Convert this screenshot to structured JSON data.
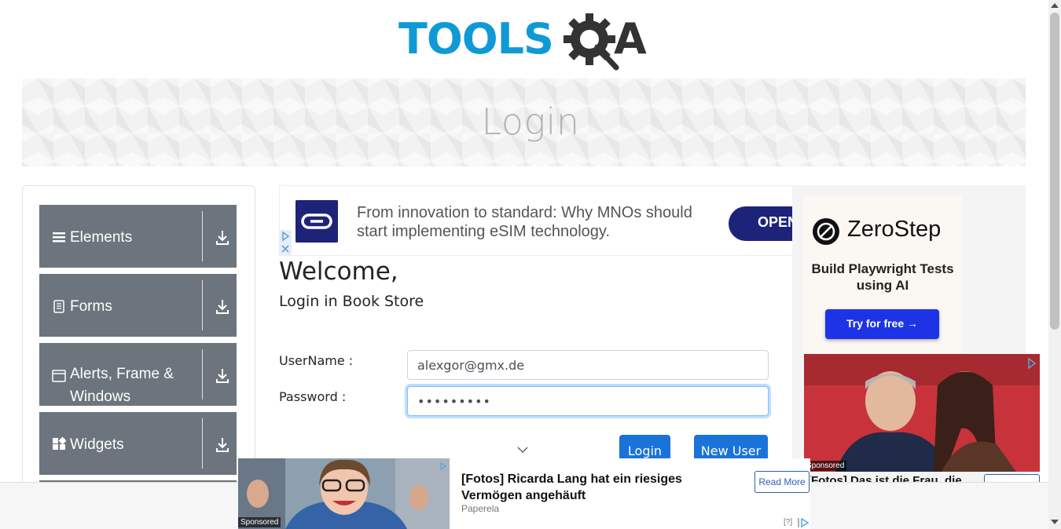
{
  "header": {
    "logo_text": "TOOLSQA",
    "banner_title": "Login"
  },
  "sidebar": {
    "groups": [
      {
        "label": "Elements",
        "icon": "list-icon"
      },
      {
        "label": "Forms",
        "icon": "document-icon"
      },
      {
        "label": "Alerts, Frame & Windows",
        "icon": "window-icon"
      },
      {
        "label": "Widgets",
        "icon": "widgets-icon"
      }
    ]
  },
  "top_ad": {
    "text": "From innovation to standard: Why MNOs should start implementing eSIM technology.",
    "button": "OPEN"
  },
  "form": {
    "welcome": "Welcome,",
    "subtitle": "Login in Book Store",
    "username_label": "UserName :",
    "username_value": "alexgor@gmx.de",
    "password_label": "Password :",
    "password_value": "•••••••••",
    "login_button": "Login",
    "new_user_button": "New User"
  },
  "right_ad": {
    "brand": "ZeroStep",
    "tagline": "Build Playwright Tests using AI",
    "cta": "Try for free →",
    "sponsored": "Sponsored",
    "caption": "[Fotos] Das ist die Frau, die"
  },
  "bottom_ad": {
    "title": "[Fotos] Ricarda Lang hat ein riesiges Vermögen angehäuft",
    "source": "Paperela",
    "read_more": "Read More",
    "sponsored": "Sponsored",
    "help": "[?]"
  },
  "colors": {
    "sidebar_group": "#6c757d",
    "primary_button": "#1a73d9",
    "logo_blue": "#0f9ad6",
    "logo_dark": "#333333",
    "ad_navy": "#1d2378",
    "cta_blue": "#1d34e6"
  }
}
